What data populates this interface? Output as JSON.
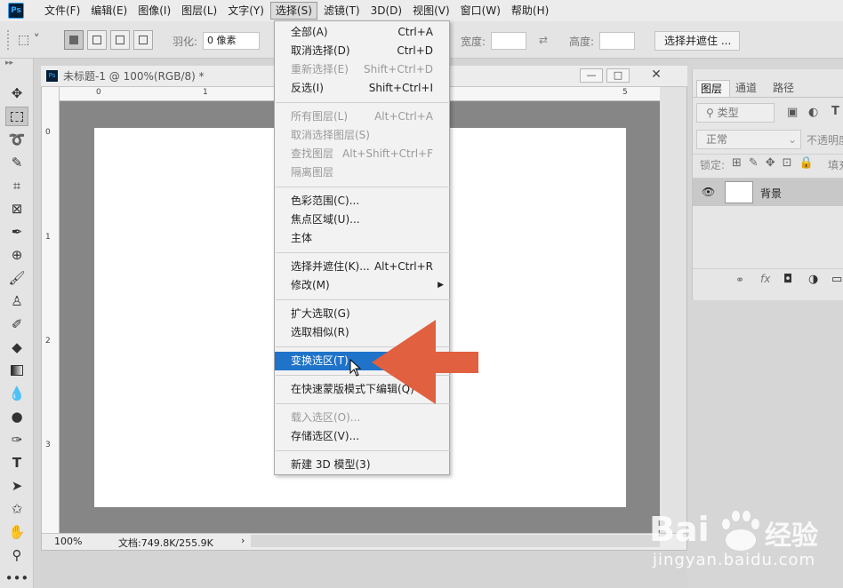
{
  "menubar": {
    "logo": "Ps",
    "items": [
      "文件(F)",
      "编辑(E)",
      "图像(I)",
      "图层(L)",
      "文字(Y)",
      "选择(S)",
      "滤镜(T)",
      "3D(D)",
      "视图(V)",
      "窗口(W)",
      "帮助(H)"
    ],
    "active_index": 5
  },
  "options": {
    "feather_label": "羽化:",
    "feather_value": "0 像素",
    "width_label": "宽度:",
    "height_label": "高度:",
    "select_mask_button": "选择并遮住 ..."
  },
  "document": {
    "tab_title": "未标题-1 @ 100%(RGB/8) *",
    "ruler_top": [
      "0",
      "1",
      "5"
    ],
    "ruler_left": [
      "0",
      "1",
      "2",
      "3"
    ],
    "zoom": "100%",
    "doc_info": "文档:749.8K/255.9K",
    "status_arrow": "›"
  },
  "layers_panel": {
    "tabs": [
      "图层",
      "通道",
      "路径"
    ],
    "filter_placeholder": "类型",
    "blend_mode": "正常",
    "opacity_label": "不透明度",
    "lock_label": "锁定:",
    "fill_label": "填充",
    "layer_name": "背景"
  },
  "select_menu": {
    "groups": [
      [
        {
          "label": "全部(A)",
          "shortcut": "Ctrl+A",
          "disabled": false
        },
        {
          "label": "取消选择(D)",
          "shortcut": "Ctrl+D",
          "disabled": false
        },
        {
          "label": "重新选择(E)",
          "shortcut": "Shift+Ctrl+D",
          "disabled": true
        },
        {
          "label": "反选(I)",
          "shortcut": "Shift+Ctrl+I",
          "disabled": false
        }
      ],
      [
        {
          "label": "所有图层(L)",
          "shortcut": "Alt+Ctrl+A",
          "disabled": true
        },
        {
          "label": "取消选择图层(S)",
          "shortcut": "",
          "disabled": true
        },
        {
          "label": "查找图层",
          "shortcut": "Alt+Shift+Ctrl+F",
          "disabled": true
        },
        {
          "label": "隔离图层",
          "shortcut": "",
          "disabled": true
        }
      ],
      [
        {
          "label": "色彩范围(C)...",
          "shortcut": "",
          "disabled": false
        },
        {
          "label": "焦点区域(U)...",
          "shortcut": "",
          "disabled": false
        },
        {
          "label": "主体",
          "shortcut": "",
          "disabled": false
        }
      ],
      [
        {
          "label": "选择并遮住(K)...",
          "shortcut": "Alt+Ctrl+R",
          "disabled": false
        },
        {
          "label": "修改(M)",
          "shortcut": "",
          "disabled": false,
          "submenu": true
        }
      ],
      [
        {
          "label": "扩大选取(G)",
          "shortcut": "",
          "disabled": false
        },
        {
          "label": "选取相似(R)",
          "shortcut": "",
          "disabled": false
        }
      ],
      [
        {
          "label": "变换选区(T)",
          "shortcut": "",
          "disabled": false,
          "highlighted": true
        }
      ],
      [
        {
          "label": "在快速蒙版模式下编辑(Q)",
          "shortcut": "",
          "disabled": false
        }
      ],
      [
        {
          "label": "载入选区(O)...",
          "shortcut": "",
          "disabled": true
        },
        {
          "label": "存储选区(V)...",
          "shortcut": "",
          "disabled": false
        }
      ],
      [
        {
          "label": "新建 3D 模型(3)",
          "shortcut": "",
          "disabled": false
        }
      ]
    ]
  },
  "watermark": {
    "brand_left": "Bai",
    "brand_right": "经验",
    "url": "jingyan.baidu.com"
  },
  "colors": {
    "highlight": "#1f73c9",
    "arrow": "#e0603f",
    "ps_dark": "#001e36",
    "ps_blue": "#31a8ff"
  }
}
